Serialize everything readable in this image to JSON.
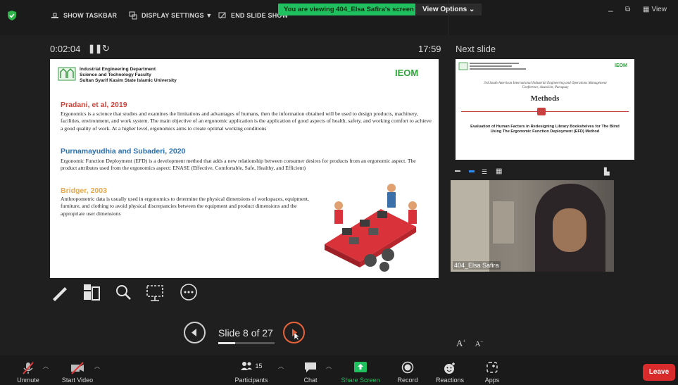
{
  "topbar": {
    "show_taskbar": "SHOW TASKBAR",
    "display_settings": "DISPLAY SETTINGS ▼",
    "end_slide_show": "END SLIDE SHOW",
    "viewing_banner": "You are viewing 404_Elsa Safira's screen",
    "view_options": "View Options ⌄",
    "view_button": "View"
  },
  "presenter": {
    "elapsed": "0:02:04",
    "clock": "17:59",
    "next_slide_label": "Next slide"
  },
  "slide": {
    "dept_lines": [
      "Industrial Engineering Department",
      "Science and Technology Faculty",
      "Sultan Syarif Kasim State Islamic University"
    ],
    "logo_text": "IEOM",
    "sections": [
      {
        "title": "Pradani, et al, 2019",
        "color": "#d1443a",
        "body": "Ergonomics is a science that studies and examines the limitations and advantages of humans, then the information obtained will be used to design products, machinery, facilities, environment, and work system. The main objective of an ergonomic application is the application of good aspects of health, safety, and working comfort to achieve a good quality of work. At a higher level, ergonomics aims to create optimal working conditions"
      },
      {
        "title": "Purnamayudhia and Subaderi, 2020",
        "color": "#2a6fb0",
        "body": "Ergonomic Function Deployment (EFD) is a development method that adds a new relationship between consumer desires for products from an ergonomic aspect. The product attributes used from the ergonomics aspect: ENASE (Effective, Comfortable, Safe, Healthy, and Efficient)"
      },
      {
        "title": "Bridger, 2003",
        "color": "#e8a84a",
        "body": "Anthropometric data is usually used in ergonomics to determine the physical dimensions of workspaces, equipment, furniture, and clothing to avoid physical discrepancies between the equipment and product dimensions and the appropriate user dimensions"
      }
    ]
  },
  "next_slide": {
    "conference": "3rd South American International Industrial Engineering and Operations Management Conference, Asunción, Paraguay",
    "heading": "Methods",
    "subtitle": "Evaluation of Human Factors in Redesigning Library Bookshelves for The Blind Using The Ergonomic Function Deployment (EFD) Method",
    "logo_text": "IEOM"
  },
  "video": {
    "participant_name": "404_Elsa Safira"
  },
  "navigation": {
    "slide_counter": "Slide 8 of 27",
    "progress_fraction": 0.296
  },
  "font_controls": {
    "larger": "A",
    "smaller": "A"
  },
  "bottombar": {
    "unmute": "Unmute",
    "start_video": "Start Video",
    "participants": "Participants",
    "participant_count": "15",
    "chat": "Chat",
    "share_screen": "Share Screen",
    "record": "Record",
    "reactions": "Reactions",
    "apps": "Apps",
    "leave": "Leave"
  },
  "colors": {
    "share_green": "#20c060",
    "leave_red": "#d92b2b",
    "next_orange": "#e8623a"
  }
}
